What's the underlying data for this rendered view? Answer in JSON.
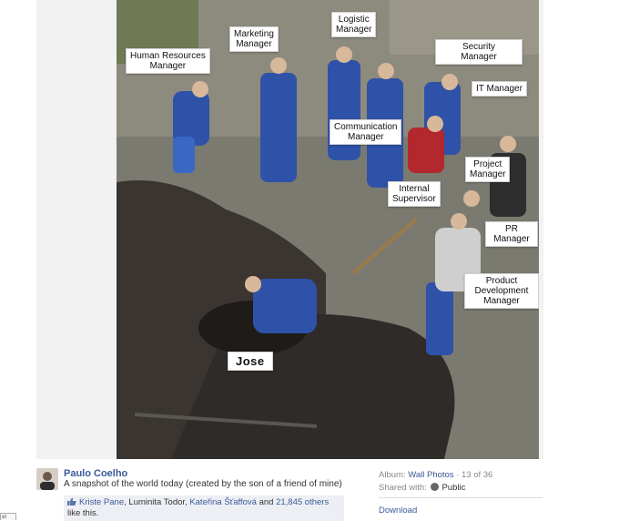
{
  "photo": {
    "labels": {
      "hr": "Human Resources\nManager",
      "marketing": "Marketing\nManager",
      "logistic": "Logistic\nManager",
      "security": "Security\nManager",
      "it": "IT Manager",
      "communication": "Communication\nManager",
      "project": "Project\nManager",
      "internal": "Internal\nSupervisor",
      "pr": "PR\nManager",
      "product": "Product\nDevelopment\nManager",
      "jose": "Jose"
    }
  },
  "post": {
    "author": "Paulo Coelho",
    "caption": "A snapshot of the world today (created by the son of a friend of mine)",
    "likes": {
      "name1": "Kriste Pane",
      "sep1": ", ",
      "name2": "Luminita Todor",
      "sep2": ", ",
      "name3": "Kateřina Šťaffová",
      "and": " and ",
      "others": "21,845 others",
      "suffix": " like this."
    }
  },
  "sidebar": {
    "album_label": "Album: ",
    "album_link": "Wall Photos",
    "album_position": " · 13 of 36",
    "shared_label": "Shared with: ",
    "shared_value": "Public",
    "download": "Download"
  },
  "corner_tab": "et"
}
